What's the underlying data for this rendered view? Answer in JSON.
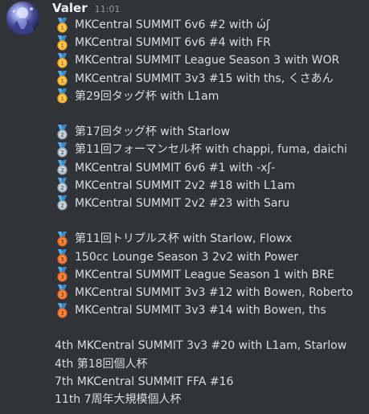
{
  "message": {
    "author": "Valer",
    "timestamp": "11:01"
  },
  "groups": [
    {
      "medal": "gold-medal-icon",
      "medal_number": "1",
      "lines": [
        "MKCentral SUMMIT 6v6 #2 with ώʃ",
        "MKCentral SUMMIT 6v6 #4 with FR",
        "MKCentral SUMMIT League Season 3 with WOR",
        "MKCentral SUMMIT 3v3 #15 with ths, くさあん",
        "第29回タッグ杯 with L1am"
      ]
    },
    {
      "medal": "silver-medal-icon",
      "medal_number": "2",
      "lines": [
        "第17回タッグ杯 with Starlow",
        "第11回フォーマンセル杯 with chappi, fuma, daichi",
        "MKCentral SUMMIT 6v6 #1 with -xʃ-",
        "MKCentral SUMMIT 2v2 #18 with L1am",
        "MKCentral SUMMIT 2v2 #23 with Saru"
      ]
    },
    {
      "medal": "bronze-medal-icon",
      "medal_number": "3",
      "lines": [
        "第11回トリプルス杯 with Starlow, Flowx",
        "150cc Lounge Season 3 2v2 with Power",
        "MKCentral SUMMIT League Season 1 with BRE",
        "MKCentral SUMMIT 3v3 #12 with Bowen, Roberto",
        "MKCentral SUMMIT 3v3 #14 with Bowen, ths"
      ]
    }
  ],
  "other_results": [
    "4th MKCentral SUMMIT 3v3 #20 with L1am, Starlow",
    "4th 第18回個人杯",
    "7th MKCentral SUMMIT FFA #16",
    "11th 7周年大規模個人杯"
  ],
  "colors": {
    "background": "#313338",
    "text": "#dbdee1",
    "username": "#f2f3f5",
    "timestamp": "#949ba4",
    "gold": "#f4a623",
    "silver": "#a6b4c4",
    "bronze": "#e0662b",
    "ribbon": "#55acee"
  }
}
